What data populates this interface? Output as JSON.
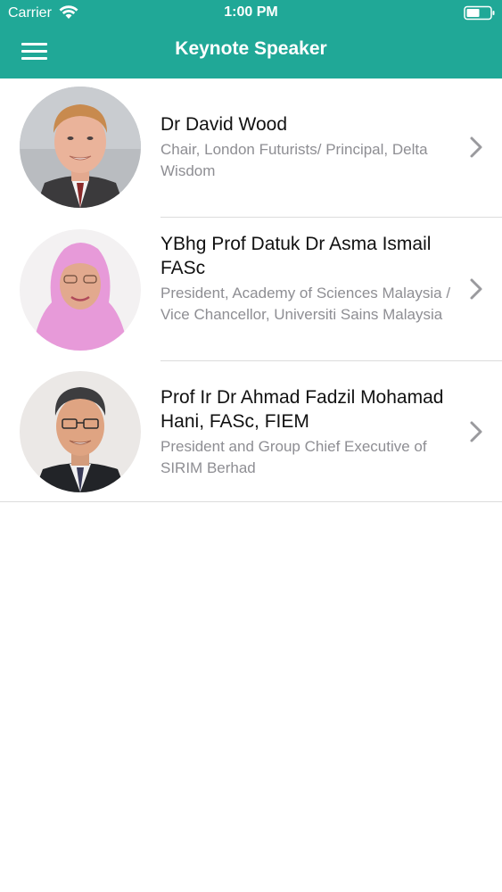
{
  "status_bar": {
    "carrier": "Carrier",
    "time": "1:00 PM",
    "wifi_icon": "wifi-icon",
    "battery_icon": "battery-icon"
  },
  "nav": {
    "title": "Keynote Speaker",
    "menu_icon": "hamburger-menu-icon",
    "background_color": "#20a897"
  },
  "speakers": [
    {
      "name": "Dr David Wood",
      "title": "Chair, London Futurists/ Principal, Delta Wisdom",
      "chevron_icon": "chevron-right-icon"
    },
    {
      "name": "YBhg Prof Datuk Dr Asma Ismail FASc",
      "title": "President, Academy of Sciences Malaysia / Vice Chancellor, Universiti Sains Malaysia",
      "chevron_icon": "chevron-right-icon"
    },
    {
      "name": "Prof Ir Dr Ahmad Fadzil Mohamad Hani, FASc, FIEM",
      "title": "President and Group Chief Executive of SIRIM Berhad",
      "chevron_icon": "chevron-right-icon"
    }
  ]
}
